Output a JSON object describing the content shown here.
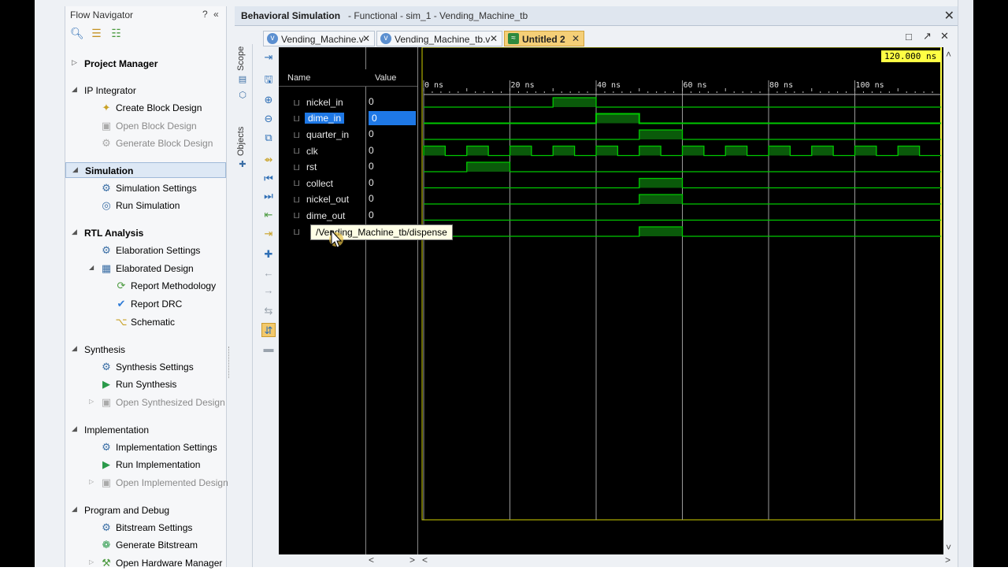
{
  "flow_navigator": {
    "title": "Flow Navigator",
    "help": "?",
    "collapse": "«",
    "tools": [
      "search-icon",
      "collapse-all-icon",
      "expand-all-icon"
    ],
    "sections": [
      {
        "label": "Project Manager",
        "bold": true
      },
      {
        "label": "IP Integrator",
        "bold": false
      },
      {
        "label": "Simulation",
        "bold": true,
        "selected": true
      },
      {
        "label": "RTL Analysis",
        "bold": true
      },
      {
        "label": "Synthesis",
        "bold": false
      },
      {
        "label": "Implementation",
        "bold": false
      },
      {
        "label": "Program and Debug",
        "bold": false
      }
    ],
    "items": {
      "create_block_design": "Create Block Design",
      "open_block_design": "Open Block Design",
      "generate_block_design": "Generate Block Design",
      "simulation_settings": "Simulation Settings",
      "run_simulation": "Run Simulation",
      "elaboration_settings": "Elaboration Settings",
      "elaborated_design": "Elaborated Design",
      "report_methodology": "Report Methodology",
      "report_drc": "Report DRC",
      "schematic": "Schematic",
      "synthesis_settings": "Synthesis Settings",
      "run_synthesis": "Run Synthesis",
      "open_synthesized_design": "Open Synthesized Design",
      "implementation_settings": "Implementation Settings",
      "run_implementation": "Run Implementation",
      "open_implemented_design": "Open Implemented Design",
      "bitstream_settings": "Bitstream Settings",
      "generate_bitstream": "Generate Bitstream",
      "open_hardware_manager": "Open Hardware Manager"
    }
  },
  "sim_header": {
    "title": "Behavioral Simulation",
    "subtitle": "- Functional - sim_1 - Vending_Machine_tb",
    "close": "✕"
  },
  "tabs": [
    {
      "label": "Vending_Machine.v",
      "close": "✕",
      "active": false
    },
    {
      "label": "Vending_Machine_tb.v",
      "close": "✕",
      "active": false
    },
    {
      "label": "Untitled 2",
      "close": "✕",
      "active": true
    }
  ],
  "side_tabs": [
    "Scope",
    "Objects"
  ],
  "wave": {
    "name_header": "Name",
    "value_header": "Value",
    "time_marker": "120.000 ns",
    "time_unit": "ns",
    "time_ticks": [
      "0 ns",
      "20 ns",
      "40 ns",
      "60 ns",
      "80 ns",
      "100 ns"
    ],
    "time_range_ns": [
      0,
      120
    ],
    "signals": [
      {
        "name": "nickel_in",
        "value": "0",
        "selected": false,
        "high": [
          [
            30,
            40
          ]
        ]
      },
      {
        "name": "dime_in",
        "value": "0",
        "selected": true,
        "high": [
          [
            40,
            50
          ]
        ]
      },
      {
        "name": "quarter_in",
        "value": "0",
        "selected": false,
        "high": [
          [
            50,
            60
          ]
        ]
      },
      {
        "name": "clk",
        "value": "0",
        "selected": false,
        "clock": true,
        "high": [
          [
            0,
            5
          ],
          [
            10,
            15
          ],
          [
            20,
            25
          ],
          [
            30,
            35
          ],
          [
            40,
            45
          ],
          [
            50,
            55
          ],
          [
            60,
            65
          ],
          [
            70,
            75
          ],
          [
            80,
            85
          ],
          [
            90,
            95
          ],
          [
            100,
            105
          ],
          [
            110,
            115
          ]
        ]
      },
      {
        "name": "rst",
        "value": "0",
        "selected": false,
        "high": [
          [
            10,
            20
          ]
        ]
      },
      {
        "name": "collect",
        "value": "0",
        "selected": false,
        "high": [
          [
            50,
            60
          ]
        ]
      },
      {
        "name": "nickel_out",
        "value": "0",
        "selected": false,
        "high": [
          [
            50,
            60
          ]
        ]
      },
      {
        "name": "dime_out",
        "value": "0",
        "selected": false,
        "high": []
      },
      {
        "name": "",
        "value": "",
        "selected": false,
        "high": [
          [
            50,
            60
          ]
        ]
      }
    ],
    "tooltip": "/Vending_Machine_tb/dispense",
    "wave_color": "#00c800"
  }
}
